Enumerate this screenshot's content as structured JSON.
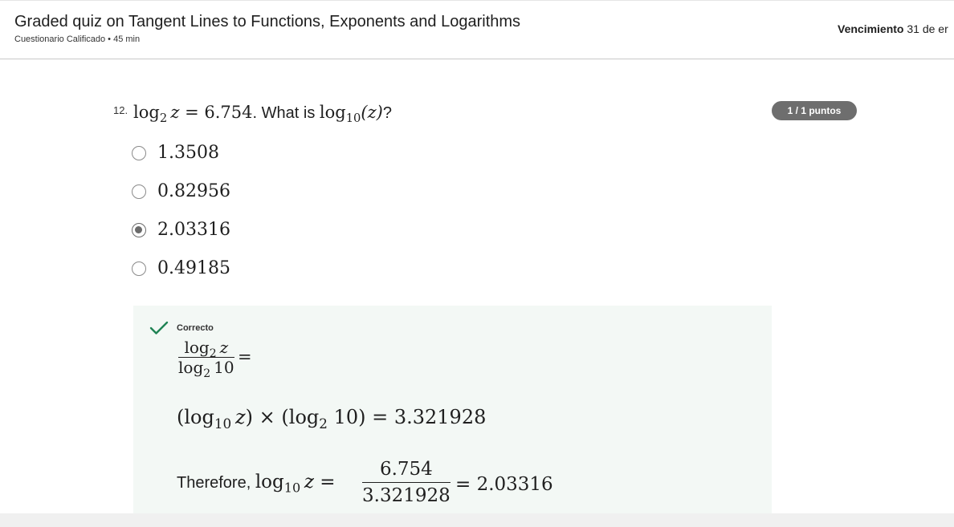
{
  "header": {
    "title": "Graded quiz on Tangent Lines to Functions, Exponents and Logarithms",
    "subtitle": "Cuestionario Calificado • 45 min",
    "due_label": "Vencimiento",
    "due_value": "31 de er"
  },
  "question": {
    "number": "12.",
    "prefix_log": "log",
    "prefix_base": "2",
    "prefix_var": "z",
    "prefix_eq": " = 6.754",
    "middle_text": ". What is ",
    "suffix_log": "log",
    "suffix_base": "10",
    "suffix_arg": "(z)",
    "end_text": "?",
    "score": "1 / 1 puntos",
    "options": [
      {
        "label": "1.3508",
        "selected": false
      },
      {
        "label": "0.82956",
        "selected": false
      },
      {
        "label": "2.03316",
        "selected": true
      },
      {
        "label": "0.49185",
        "selected": false
      }
    ]
  },
  "feedback": {
    "status": "Correcto",
    "status_color": "#1f8354",
    "icon": "checkmark-icon",
    "step1": {
      "num_log": "log",
      "num_base": "2",
      "num_var": "z",
      "den_log": "log",
      "den_base": "2",
      "den_val": "10",
      "rel": "="
    },
    "step2": {
      "open": "(log",
      "base_a": "10",
      "var_a": "z",
      "mid": ") × (log",
      "base_b": "2",
      "close": " 10) = 3.321928"
    },
    "step3": {
      "lead": "Therefore, ",
      "log": "log",
      "base": "10",
      "var": "z",
      "eq": " =",
      "num": "6.754",
      "den": "3.321928",
      "result": "= 2.03316"
    }
  }
}
